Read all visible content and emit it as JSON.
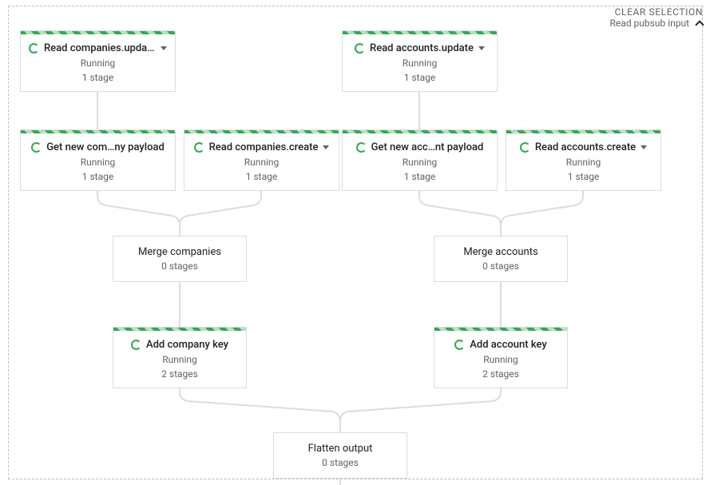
{
  "header": {
    "clear": "CLEAR SELECTION",
    "section": "Read pubsub input"
  },
  "nodes": {
    "readCompaniesUpdate": {
      "title": "Read companies.update",
      "status": "Running",
      "stages": "1 stage"
    },
    "readAccountsUpdate": {
      "title": "Read accounts.update",
      "status": "Running",
      "stages": "1 stage"
    },
    "getNewCompanyPayload": {
      "title": "Get new com…ny payload",
      "status": "Running",
      "stages": "1 stage"
    },
    "readCompaniesCreate": {
      "title": "Read companies.create",
      "status": "Running",
      "stages": "1 stage"
    },
    "getNewAccountPayload": {
      "title": "Get new acc…nt payload",
      "status": "Running",
      "stages": "1 stage"
    },
    "readAccountsCreate": {
      "title": "Read accounts.create",
      "status": "Running",
      "stages": "1 stage"
    },
    "mergeCompanies": {
      "title": "Merge companies",
      "stages": "0 stages"
    },
    "mergeAccounts": {
      "title": "Merge accounts",
      "stages": "0 stages"
    },
    "addCompanyKey": {
      "title": "Add company key",
      "status": "Running",
      "stages": "2 stages"
    },
    "addAccountKey": {
      "title": "Add account key",
      "status": "Running",
      "stages": "2 stages"
    },
    "flattenOutput": {
      "title": "Flatten output",
      "stages": "0 stages"
    }
  }
}
